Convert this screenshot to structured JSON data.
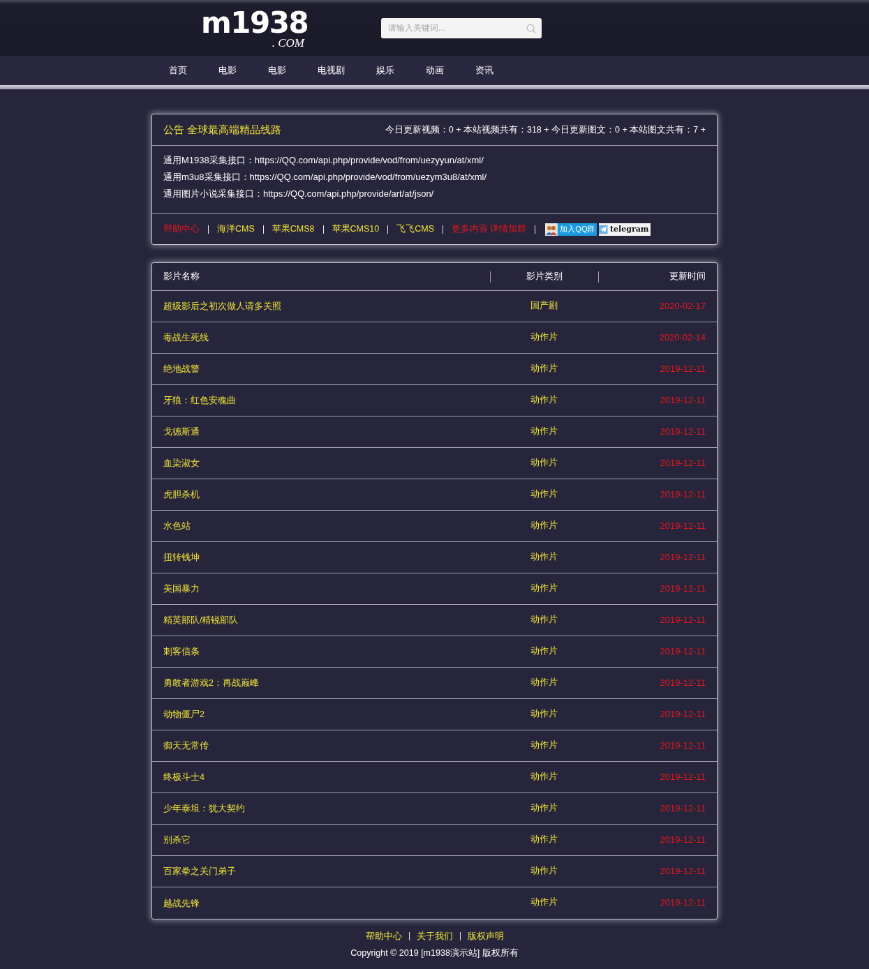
{
  "header": {
    "logo": {
      "name": "m1938",
      "suffix": ". COM"
    },
    "search": {
      "placeholder": "请输入关键词..."
    }
  },
  "nav": {
    "items": [
      "首页",
      "电影",
      "电影",
      "电视剧",
      "娱乐",
      "动画",
      "资讯"
    ]
  },
  "notice": {
    "title": "公告 全球最高端精品线路",
    "stats": "今日更新视频：0 + 本站视频共有：318 + 今日更新图文：0 + 本站图文共有：7 +",
    "apis": [
      "通用M1938采集接口：https://QQ.com/api.php/provide/vod/from/uezyyun/at/xml/",
      "通用m3u8采集接口：https://QQ.com/api.php/provide/vod/from/uezym3u8/at/xml/",
      "通用图片小说采集接口：https://QQ.com/api.php/provide/art/at/json/"
    ],
    "links": [
      {
        "label": "帮助中心",
        "kind": "highlight"
      },
      {
        "label": "海洋CMS",
        "kind": "plain"
      },
      {
        "label": "苹果CMS8",
        "kind": "plain"
      },
      {
        "label": "苹果CMS10",
        "kind": "plain"
      },
      {
        "label": "飞飞CMS",
        "kind": "plain"
      },
      {
        "label": "更多内容 详情加群",
        "kind": "highlight"
      }
    ],
    "badges": [
      {
        "kind": "qq",
        "label": "加入QQ群"
      },
      {
        "kind": "telegram",
        "label": "telegram"
      }
    ]
  },
  "table": {
    "columns": [
      "影片名称",
      "影片类别",
      "更新时间"
    ],
    "rows": [
      {
        "name": "超级影后之初次做人请多关照",
        "category": "国产剧",
        "date": "2020-02-17"
      },
      {
        "name": "毒战生死线",
        "category": "动作片",
        "date": "2020-02-14"
      },
      {
        "name": "绝地战警",
        "category": "动作片",
        "date": "2019-12-11"
      },
      {
        "name": "牙狼：红色安魂曲",
        "category": "动作片",
        "date": "2019-12-11"
      },
      {
        "name": "戈德斯通",
        "category": "动作片",
        "date": "2019-12-11"
      },
      {
        "name": "血染淑女",
        "category": "动作片",
        "date": "2019-12-11"
      },
      {
        "name": "虎胆杀机",
        "category": "动作片",
        "date": "2019-12-11"
      },
      {
        "name": "水色站",
        "category": "动作片",
        "date": "2019-12-11"
      },
      {
        "name": "扭转钱坤",
        "category": "动作片",
        "date": "2019-12-11"
      },
      {
        "name": "美国暴力",
        "category": "动作片",
        "date": "2019-12-11"
      },
      {
        "name": "精英部队/精锐部队",
        "category": "动作片",
        "date": "2019-12-11"
      },
      {
        "name": "刺客信条",
        "category": "动作片",
        "date": "2019-12-11"
      },
      {
        "name": "勇敢者游戏2：再战巅峰",
        "category": "动作片",
        "date": "2019-12-11"
      },
      {
        "name": "动物僵尸2",
        "category": "动作片",
        "date": "2019-12-11"
      },
      {
        "name": "御天无常传",
        "category": "动作片",
        "date": "2019-12-11"
      },
      {
        "name": "终极斗士4",
        "category": "动作片",
        "date": "2019-12-11"
      },
      {
        "name": "少年泰坦：犹大契约",
        "category": "动作片",
        "date": "2019-12-11"
      },
      {
        "name": "别杀它",
        "category": "动作片",
        "date": "2019-12-11"
      },
      {
        "name": "百家拳之关门弟子",
        "category": "动作片",
        "date": "2019-12-11"
      },
      {
        "name": "越战先锋",
        "category": "动作片",
        "date": "2019-12-11"
      }
    ]
  },
  "footer": {
    "links": [
      "帮助中心",
      "关于我们",
      "版权声明"
    ],
    "copyright": "Copyright © 2019 [m1938演示站] 版权所有"
  }
}
